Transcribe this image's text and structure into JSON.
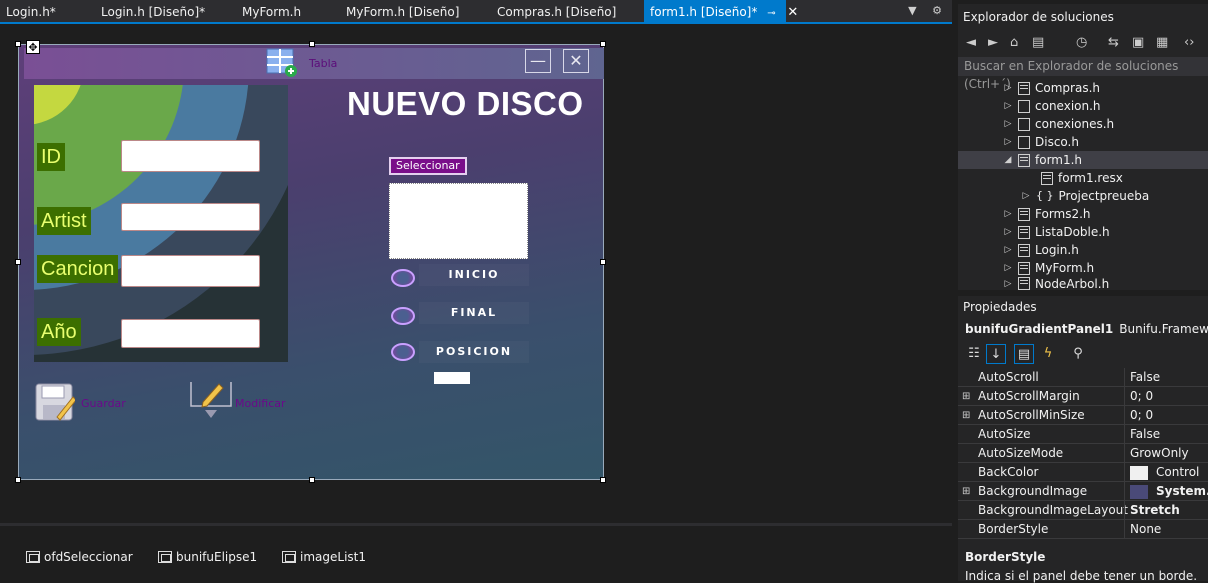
{
  "tabs": [
    {
      "label": "Login.h*",
      "active": false
    },
    {
      "label": "Login.h [Diseño]*",
      "active": false
    },
    {
      "label": "MyForm.h",
      "active": false
    },
    {
      "label": "MyForm.h [Diseño]",
      "active": false
    },
    {
      "label": "Compras.h [Diseño]",
      "active": false
    },
    {
      "label": "form1.h [Diseño]*",
      "active": true,
      "pin": "⊸",
      "close": "✕"
    }
  ],
  "tab_tools": "▼ ⚙",
  "form": {
    "tabla_label": "Tabla",
    "minimize": "—",
    "close": "✕",
    "title": "NUEVO DISCO",
    "fields": [
      {
        "label": "ID"
      },
      {
        "label": "Artist"
      },
      {
        "label": "Cancion"
      },
      {
        "label": "Año"
      }
    ],
    "seleccionar_button": "Seleccionar",
    "radios": [
      {
        "label": "INICIO"
      },
      {
        "label": "FINAL"
      },
      {
        "label": "POSICION"
      }
    ],
    "guardar_label": "Guardar",
    "modificar_label": "Modificar",
    "move_glyph": "✥"
  },
  "tray": [
    {
      "label": "ofdSeleccionar"
    },
    {
      "label": "bunifuElipse1"
    },
    {
      "label": "imageList1"
    }
  ],
  "solution_explorer": {
    "title": "Explorador de soluciones",
    "toolbar_icons": [
      "back-icon",
      "forward-icon",
      "home-icon",
      "switch-views-icon",
      "history-icon",
      "sync-icon",
      "collapse-icon",
      "properties-icon",
      "code-icon"
    ],
    "search_placeholder": "Buscar en Explorador de soluciones (Ctrl+´)",
    "items": [
      {
        "label": "Compras.h",
        "icon": "form-file-icon",
        "expand": "collapsed"
      },
      {
        "label": "conexion.h",
        "icon": "header-file-icon",
        "expand": "collapsed"
      },
      {
        "label": "conexiones.h",
        "icon": "header-file-icon",
        "expand": "collapsed"
      },
      {
        "label": "Disco.h",
        "icon": "header-file-icon",
        "expand": "collapsed"
      },
      {
        "label": "form1.h",
        "icon": "form-file-icon",
        "expand": "expanded"
      },
      {
        "label": "form1.resx",
        "icon": "resource-file-icon",
        "expand": "none"
      },
      {
        "label": "Projectpreueba",
        "icon": "namespace-icon",
        "expand": "collapsed"
      },
      {
        "label": "Forms2.h",
        "icon": "form-file-icon",
        "expand": "collapsed"
      },
      {
        "label": "ListaDoble.h",
        "icon": "form-file-icon",
        "expand": "collapsed"
      },
      {
        "label": "Login.h",
        "icon": "form-file-icon",
        "expand": "collapsed"
      },
      {
        "label": "MyForm.h",
        "icon": "form-file-icon",
        "expand": "collapsed"
      },
      {
        "label": "NodeArbol.h",
        "icon": "form-file-icon",
        "expand": "collapsed"
      }
    ]
  },
  "properties": {
    "title": "Propiedades",
    "object_name": "bunifuGradientPanel1",
    "object_type": "Bunifu.Framework.UI.",
    "toolbar_icons": [
      "categorized-icon",
      "alphabetical-icon",
      "properties-icon",
      "events-icon",
      "property-pages-icon"
    ],
    "rows": [
      {
        "name": "AutoScroll",
        "value": "False",
        "expandable": false,
        "bold": false
      },
      {
        "name": "AutoScrollMargin",
        "value": "0; 0",
        "expandable": true,
        "bold": false
      },
      {
        "name": "AutoScrollMinSize",
        "value": "0; 0",
        "expandable": true,
        "bold": false
      },
      {
        "name": "AutoSize",
        "value": "False",
        "expandable": false,
        "bold": false
      },
      {
        "name": "AutoSizeMode",
        "value": "GrowOnly",
        "expandable": false,
        "bold": false
      },
      {
        "name": "BackColor",
        "value": "Control",
        "expandable": false,
        "bold": false,
        "swatch": "#f0f0f0"
      },
      {
        "name": "BackgroundImage",
        "value": "System.D",
        "expandable": true,
        "bold": true,
        "swatch": "#4a4a78"
      },
      {
        "name": "BackgroundImageLayout",
        "value": "Stretch",
        "expandable": false,
        "bold": true
      },
      {
        "name": "BorderStyle",
        "value": "None",
        "expandable": false,
        "bold": false
      }
    ],
    "description_title": "BorderStyle",
    "description_text": "Indica si el panel debe tener un borde."
  }
}
